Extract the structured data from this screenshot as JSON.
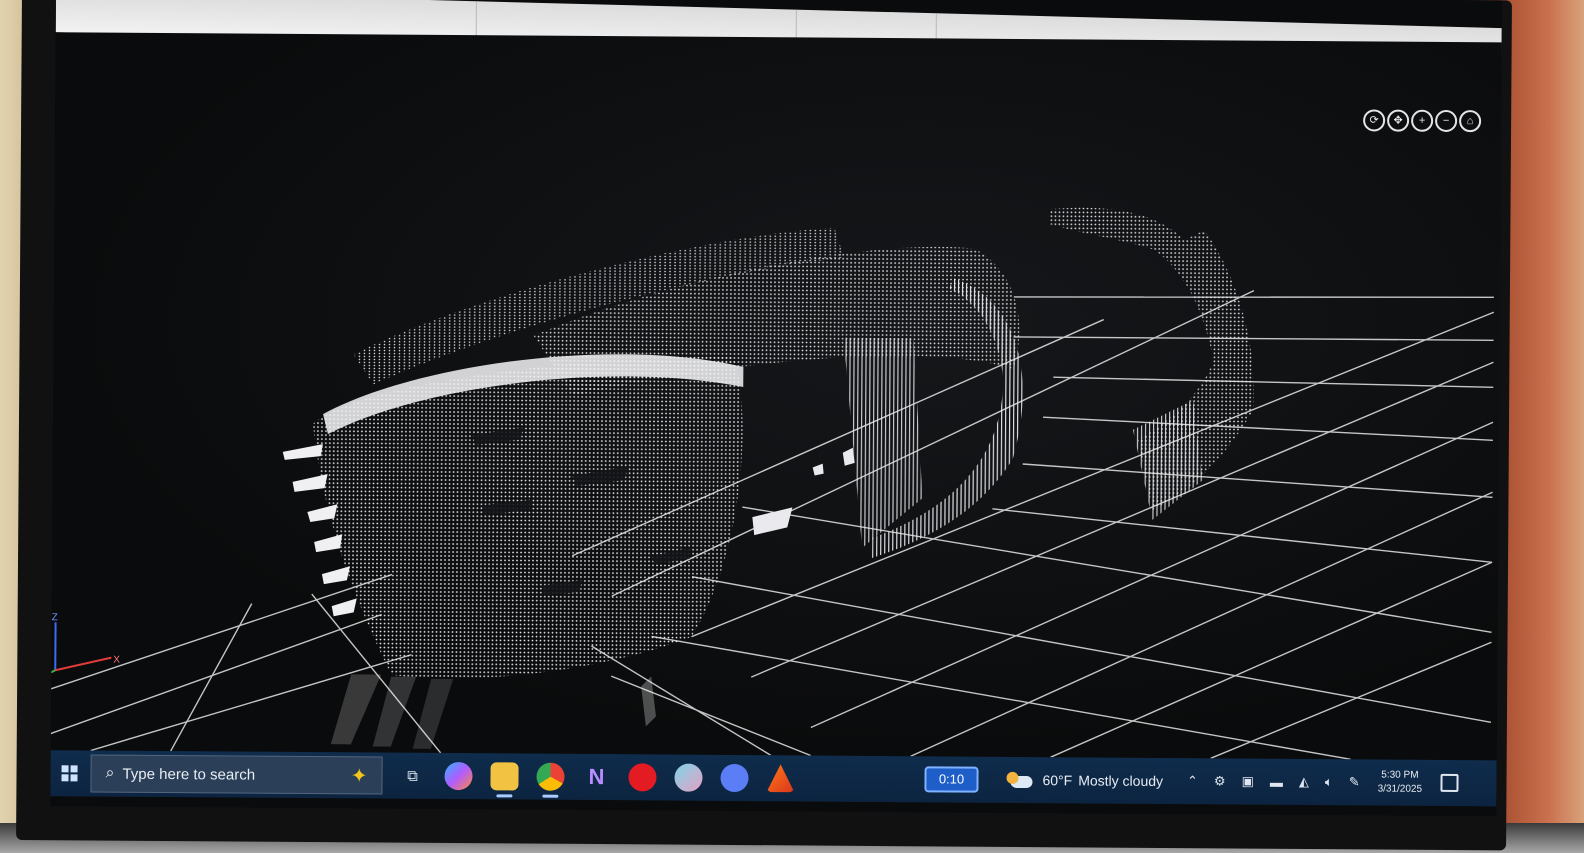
{
  "window": {
    "title": ""
  },
  "viewport": {
    "toolbar_icons": [
      "orbit-icon",
      "pan-icon",
      "zoom-in-icon",
      "zoom-out-icon",
      "home-icon"
    ],
    "axis_labels": {
      "z": "Z",
      "x": "X"
    }
  },
  "taskbar": {
    "search_placeholder": "Type here to search",
    "pinned_apps": [
      {
        "name": "task-view-icon",
        "glyph": "⧉"
      },
      {
        "name": "copilot-icon",
        "glyph": "◉"
      },
      {
        "name": "file-explorer-icon",
        "glyph": "▭"
      },
      {
        "name": "chrome-icon",
        "glyph": "◍"
      },
      {
        "name": "visual-studio-icon",
        "glyph": "N"
      },
      {
        "name": "red-app-icon",
        "glyph": "●"
      },
      {
        "name": "app-icon-2",
        "glyph": "◐"
      },
      {
        "name": "discord-icon",
        "glyph": "◒"
      },
      {
        "name": "matlab-icon",
        "glyph": "▲"
      }
    ],
    "timer": "0:10",
    "weather": {
      "temperature": "60°F",
      "condition": "Mostly cloudy"
    },
    "tray_icons": [
      "chevron-up-icon",
      "bluetooth-icon",
      "display-icon",
      "battery-icon",
      "network-icon",
      "volume-icon",
      "pen-icon"
    ],
    "clock": {
      "time": "5:30 PM",
      "date": "3/31/2025"
    }
  },
  "colors": {
    "taskbar_bg": "#0c2440",
    "viewport_bg": "#0a0b0c",
    "point_cloud": "#f2f2f4",
    "grid": "#e6e6e6",
    "timer_accent": "#1e5ec9"
  }
}
